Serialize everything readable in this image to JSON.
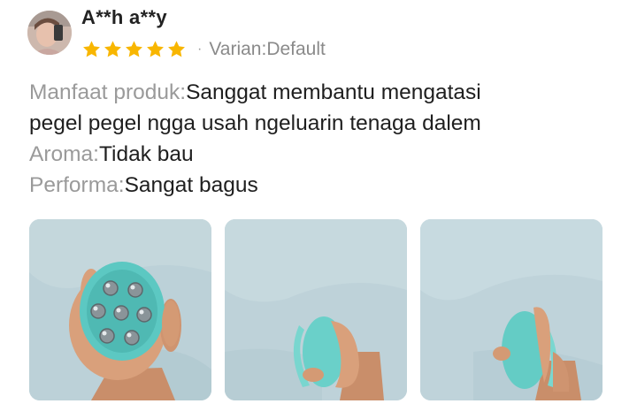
{
  "review": {
    "username": "A**h a**y",
    "rating": 5,
    "rating_max": 5,
    "star_color": "#F8B600",
    "separator": "·",
    "variant_label": "Varian: ",
    "variant_value": "Default",
    "fields": [
      {
        "key": "Manfaat produk:",
        "value_lines": [
          "Sanggat membantu mengatasi",
          "pegel pegel ngga usah ngeluarin tenaga dalem"
        ]
      },
      {
        "key": "Aroma:",
        "value": "Tidak bau"
      },
      {
        "key": "Performa:",
        "value": "Sangat bagus"
      }
    ],
    "photos": [
      {
        "icon": "massager-front-photo"
      },
      {
        "icon": "massager-side-photo"
      },
      {
        "icon": "massager-side-photo"
      }
    ],
    "colors": {
      "key_text": "#9A9A9A",
      "body_text": "#1F1F1F",
      "product": "#5CC8C2",
      "photo_bg": "#BCD1D8"
    }
  }
}
